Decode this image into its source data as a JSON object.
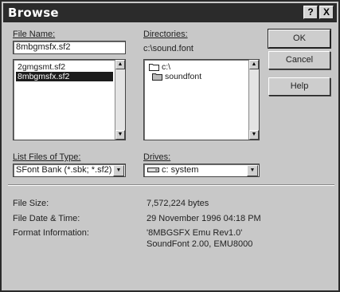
{
  "window": {
    "title": "Browse",
    "help_glyph": "?",
    "close_glyph": "X"
  },
  "filename": {
    "label": "File Name:",
    "value": "8mbgmsfx.sf2",
    "files": [
      "2gmgsmt.sf2",
      "8mbgmsfx.sf2"
    ],
    "selected_index": 1
  },
  "directories": {
    "label": "Directories:",
    "path": "c:\\sound.font",
    "items": [
      "c:\\",
      "soundfont"
    ]
  },
  "filetypes": {
    "label": "List Files of Type:",
    "value": "SFont Bank (*.sbk; *.sf2)"
  },
  "drives": {
    "label": "Drives:",
    "value": "c: system"
  },
  "buttons": {
    "ok": "OK",
    "cancel": "Cancel",
    "help": "Help"
  },
  "info": {
    "size_label": "File Size:",
    "size_value": "7,572,224 bytes",
    "date_label": "File Date & Time:",
    "date_value": "29 November 1996 04:18 PM",
    "format_label": "Format Information:",
    "format_line1": "'8MBGSFX Emu Rev1.0'",
    "format_line2": "SoundFont 2.00, EMU8000"
  },
  "icons": [
    "help-icon",
    "close-icon",
    "folder-icon",
    "scroll-up-icon",
    "scroll-down-icon",
    "dropdown-arrow-icon"
  ]
}
